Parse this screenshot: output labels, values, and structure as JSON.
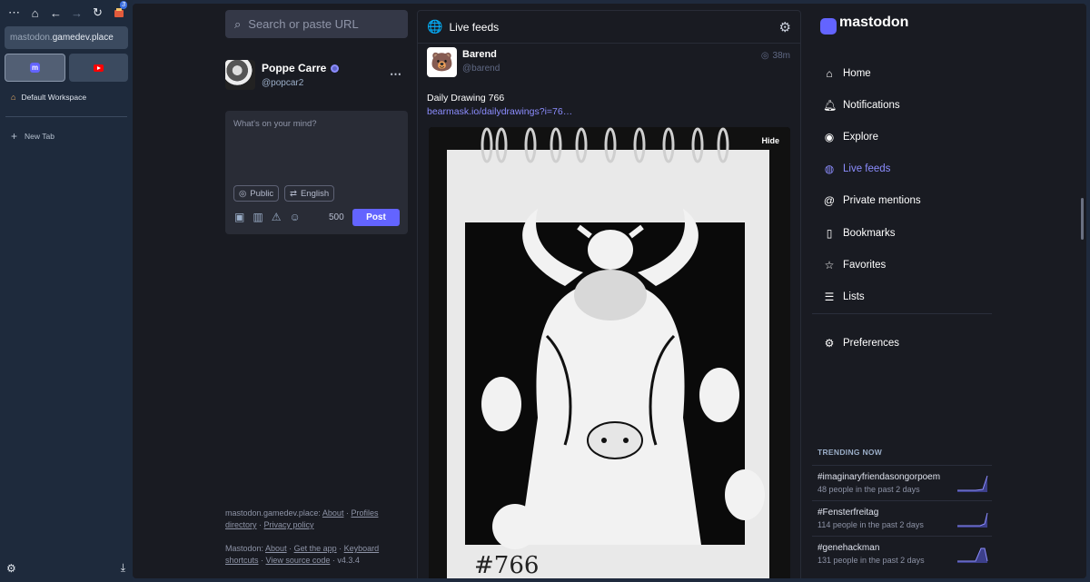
{
  "browser": {
    "url_host": "mastodon.",
    "url_domain": "gamedev.place",
    "badge_count": "3",
    "workspace_label": "Default Workspace",
    "new_tab_label": "New Tab"
  },
  "search": {
    "placeholder": "Search or paste URL"
  },
  "profile": {
    "name": "Poppe Carre",
    "handle": "@popcar2"
  },
  "compose": {
    "placeholder": "What's on your mind?",
    "visibility_label": "Public",
    "language_label": "English",
    "char_counter": "500",
    "post_label": "Post"
  },
  "footer": {
    "instance": "mastodon.gamedev.place",
    "about": "About",
    "profiles_directory": "Profiles directory",
    "privacy_policy": "Privacy policy",
    "mastodon": "Mastodon",
    "about2": "About",
    "get_app": "Get the app",
    "keyboard_shortcuts": "Keyboard shortcuts",
    "view_source": "View source code",
    "version": "v4.3.4"
  },
  "column": {
    "title": "Live feeds"
  },
  "status": {
    "display_name": "Barend",
    "handle": "@barend",
    "time": "38m",
    "text": "Daily Drawing 766",
    "link": "bearmask.io/dailydrawings?i=76…",
    "hide_label": "Hide",
    "image_caption": "#766"
  },
  "nav": {
    "logo_text": "mastodon",
    "items": [
      {
        "label": "Home",
        "icon": "home-icon"
      },
      {
        "label": "Notifications",
        "icon": "bell-icon"
      },
      {
        "label": "Explore",
        "icon": "compass-icon"
      },
      {
        "label": "Live feeds",
        "icon": "globe-icon"
      },
      {
        "label": "Private mentions",
        "icon": "at-icon"
      },
      {
        "label": "Bookmarks",
        "icon": "bookmark-icon"
      },
      {
        "label": "Favorites",
        "icon": "star-icon"
      },
      {
        "label": "Lists",
        "icon": "list-icon"
      }
    ],
    "preferences": "Preferences"
  },
  "trending": {
    "title": "TRENDING NOW",
    "items": [
      {
        "tag": "#imaginaryfriendasongorpoem",
        "count": "48 people in the past 2 days"
      },
      {
        "tag": "#Fensterfreitag",
        "count": "114 people in the past 2 days"
      },
      {
        "tag": "#genehackman",
        "count": "131 people in the past 2 days"
      }
    ]
  },
  "colors": {
    "accent": "#6364ff",
    "accent_text": "#8c8dff",
    "background": "#191b22"
  }
}
